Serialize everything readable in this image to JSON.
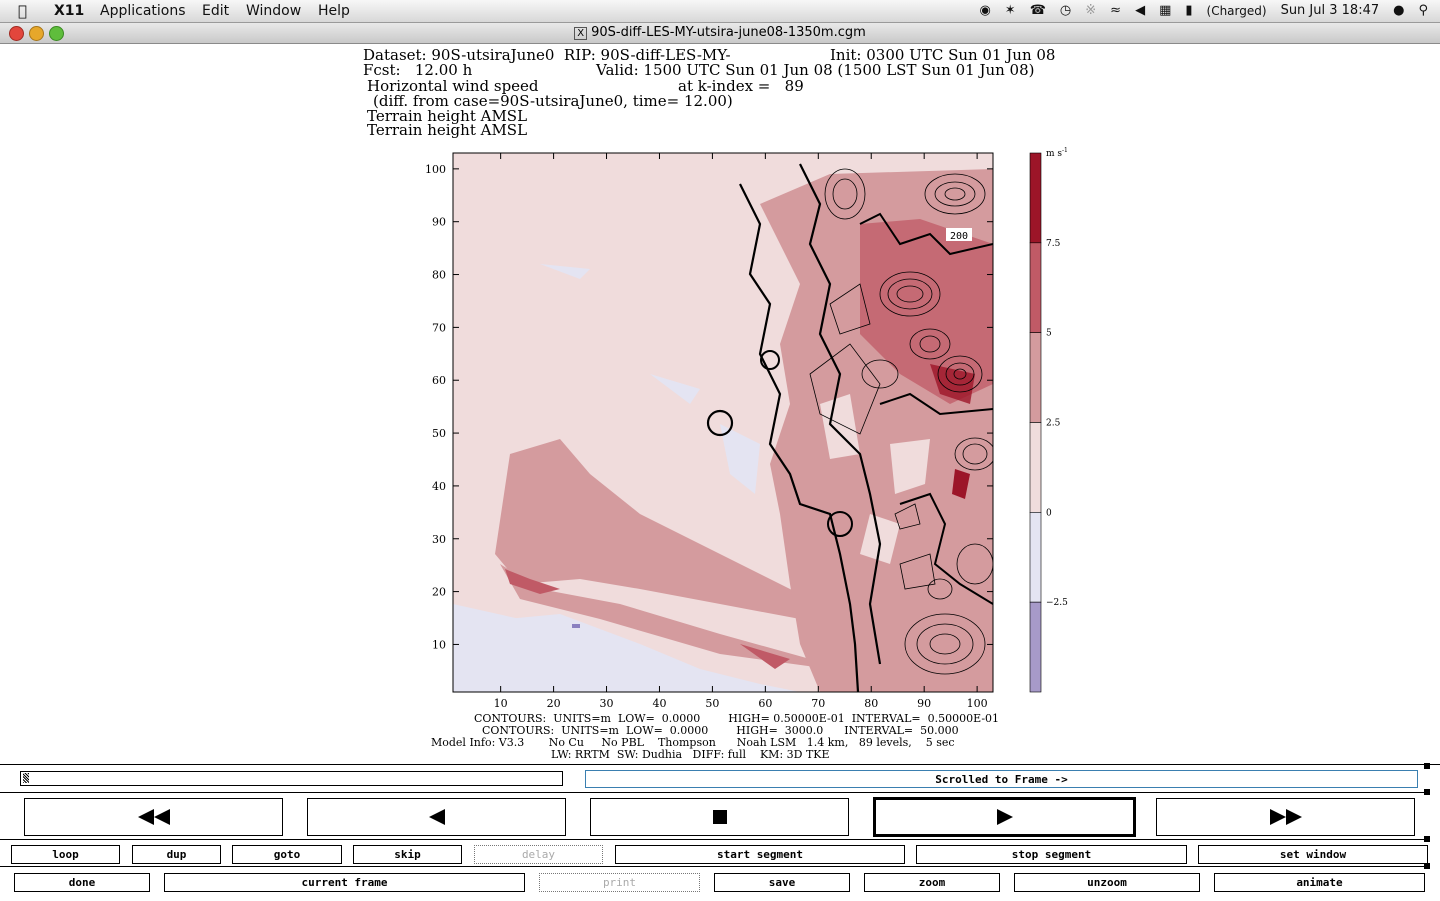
{
  "menubar": {
    "app": "X11",
    "items": [
      "Applications",
      "Edit",
      "Window",
      "Help"
    ],
    "battery": "(Charged)",
    "clock": "Sun Jul 3  18:47"
  },
  "window": {
    "title": "90S-diff-LES-MY-utsira-june08-1350m.cgm"
  },
  "plot_header": {
    "line1a": "Dataset: 90S-utsiraJune0  RIP: 90S-diff-LES-MY-",
    "line1b": "Init: 0300 UTC Sun 01 Jun 08",
    "line2a": "Fcst:   12.00 h",
    "line2b": "Valid: 1500 UTC Sun 01 Jun 08 (1500 LST Sun 01 Jun 08)",
    "line3a": "Horizontal wind speed",
    "line3b": "at k-index =   89",
    "line4": "(diff. from case=90S-utsiraJune0, time= 12.00)",
    "line5": "Terrain height AMSL",
    "line6": "Terrain height AMSL"
  },
  "plot_footer": {
    "line1": "CONTOURS:  UNITS=m  LOW=  0.0000        HIGH= 0.50000E-01  INTERVAL=  0.50000E-01",
    "line2": "CONTOURS:  UNITS=m  LOW=  0.0000        HIGH=  3000.0      INTERVAL=  50.000",
    "line3": "Model Info: V3.3       No Cu     No PBL    Thompson      Noah LSM   1.4 km,   89 levels,    5 sec",
    "line4": "LW: RRTM  SW: Dudhia   DIFF: full    KM: 3D TKE"
  },
  "chart_data": {
    "type": "heatmap",
    "x_ticks": [
      10,
      20,
      30,
      40,
      50,
      60,
      70,
      80,
      90,
      100
    ],
    "y_ticks": [
      10,
      20,
      30,
      40,
      50,
      60,
      70,
      80,
      90,
      100
    ],
    "xlim": [
      1,
      103
    ],
    "ylim": [
      1,
      103
    ],
    "contour_label": "200",
    "colorbar": {
      "unit": "m s",
      "unit_exp": "-1",
      "labels": [
        "7.5",
        "5",
        "2.5",
        "0",
        "−2.5"
      ],
      "bands": [
        {
          "from": 7.5,
          "to": 10,
          "color": "#9c1528"
        },
        {
          "from": 5,
          "to": 7.5,
          "color": "#c05a66"
        },
        {
          "from": 2.5,
          "to": 5,
          "color": "#d49b9e"
        },
        {
          "from": 0,
          "to": 2.5,
          "color": "#f0dcdc"
        },
        {
          "from": -2.5,
          "to": 0,
          "color": "#e4e4f2"
        },
        {
          "from": -5,
          "to": -2.5,
          "color": "#a79ac9"
        }
      ]
    }
  },
  "frame_status": "Scrolled to Frame ->",
  "buttons_row1": [
    "loop",
    "dup",
    "goto",
    "skip",
    "delay",
    "start segment",
    "stop segment",
    "set window"
  ],
  "buttons_row2": [
    "done",
    "current frame",
    "print",
    "save",
    "zoom",
    "unzoom",
    "animate"
  ]
}
